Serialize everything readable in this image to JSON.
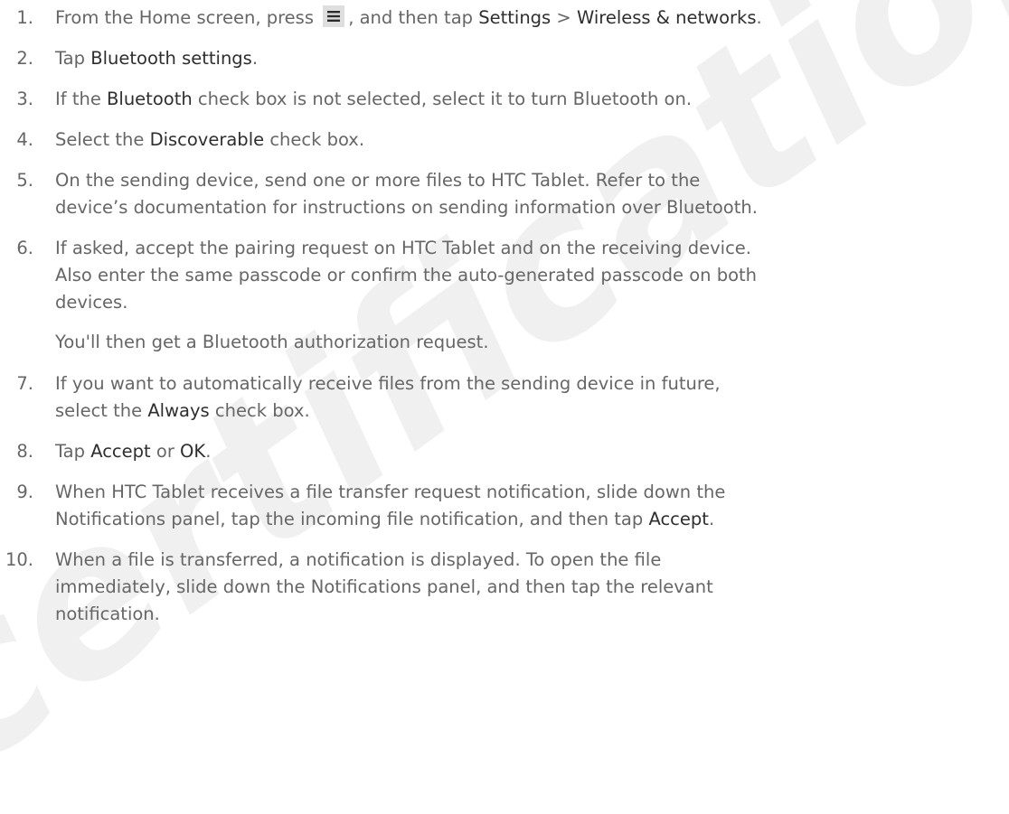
{
  "watermark": "certification",
  "steps": [
    {
      "number": "1.",
      "prefix": "From the Home screen, press",
      "icon": "menu-icon",
      "middle": ", and then tap",
      "bold1": "Settings",
      "separator": ">",
      "bold2": "Wireless & networks",
      "end": "."
    },
    {
      "number": "2.",
      "pre": "Tap",
      "bold": "Bluetooth settings",
      "post": "."
    },
    {
      "number": "3.",
      "pre": "If the",
      "bold": "Bluetooth",
      "post": "check box is not selected, select it to turn Bluetooth on."
    },
    {
      "number": "4.",
      "pre": "Select the",
      "bold": "Discoverable",
      "post": "check box."
    },
    {
      "number": "5.",
      "line1": "On the sending device, send one or more files to HTC Tablet. Refer to the",
      "line2": "device’s documentation for instructions on sending information over Bluetooth."
    },
    {
      "number": "6.",
      "line1": "If asked, accept the pairing request on HTC Tablet and on the receiving device.",
      "line2": "Also enter the same passcode or confirm the auto-generated passcode on both",
      "line3": "devices.",
      "note": "You'll then get a Bluetooth authorization request."
    },
    {
      "number": "7.",
      "line1": "If you want to automatically receive files from the sending device in future,",
      "pre2": "select the",
      "bold": "Always",
      "post2": "check box."
    },
    {
      "number": "8.",
      "pre": "Tap",
      "bold1": "Accept",
      "mid": "or",
      "bold2": "OK",
      "post": "."
    },
    {
      "number": "9.",
      "line1": "When HTC Tablet receives a file transfer request notification, slide down the",
      "pre2": "Notifications panel, tap the incoming file notification, and then tap",
      "bold": "Accept",
      "post2": "."
    },
    {
      "number": "10.",
      "line1": "When a file is transferred, a notification is displayed. To open the file",
      "line2": "immediately, slide down the Notifications panel, and then tap the relevant",
      "line3": "notification."
    }
  ]
}
